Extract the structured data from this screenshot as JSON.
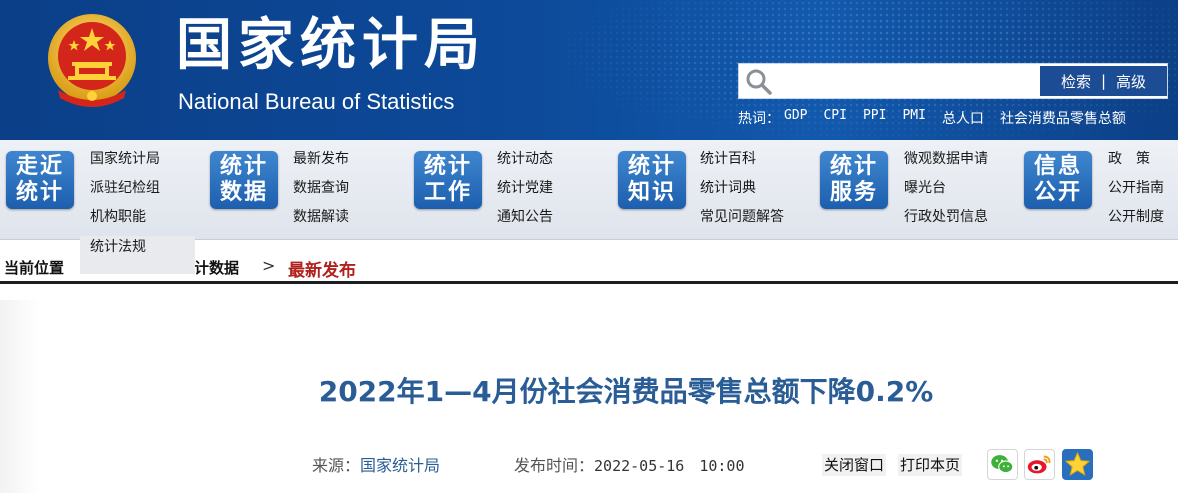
{
  "header": {
    "title_cn": "国家统计局",
    "title_en": "National Bureau of Statistics",
    "search": {
      "placeholder": "",
      "search_label": "检索",
      "separator": "|",
      "advanced_label": "高级"
    },
    "hotwords_label": "热词：",
    "hotwords": [
      "GDP",
      "CPI",
      "PPI",
      "PMI",
      "总人口",
      "社会消费品零售总额"
    ]
  },
  "nav": [
    {
      "tile": [
        "走近",
        "统计"
      ],
      "links": [
        "国家统计局",
        "派驻纪检组",
        "机构职能"
      ]
    },
    {
      "tile": [
        "统计",
        "数据"
      ],
      "links": [
        "最新发布",
        "数据查询",
        "数据解读"
      ]
    },
    {
      "tile": [
        "统计",
        "工作"
      ],
      "links": [
        "统计动态",
        "统计党建",
        "通知公告"
      ]
    },
    {
      "tile": [
        "统计",
        "知识"
      ],
      "links": [
        "统计百科",
        "统计词典",
        "常见问题解答"
      ]
    },
    {
      "tile": [
        "统计",
        "服务"
      ],
      "links": [
        "微观数据申请",
        "曝光台",
        "行政处罚信息"
      ]
    },
    {
      "tile": [
        "信息",
        "公开"
      ],
      "links": [
        "政　策",
        "公开指南",
        "公开制度"
      ]
    }
  ],
  "dropdown": {
    "item": "统计法规"
  },
  "breadcrumb": {
    "label": "当前位置",
    "items": [
      "计数据"
    ],
    "separator": ">",
    "current": "最新发布"
  },
  "article": {
    "title": "2022年1—4月份社会消费品零售总额下降0.2%",
    "source_label": "来源：",
    "source": "国家统计局",
    "time_label": "发布时间：",
    "time": "2022-05-16　10:00",
    "close_label": "关闭窗口",
    "print_label": "打印本页"
  },
  "colors": {
    "header_blue": "#0d4a9a",
    "title_blue": "#2a5d96",
    "current_red": "#b1211c",
    "tile_blue": "#2a6fbe"
  },
  "icons": [
    "national-emblem-icon",
    "search-icon",
    "wechat-icon",
    "weibo-icon",
    "favorite-star-icon"
  ]
}
